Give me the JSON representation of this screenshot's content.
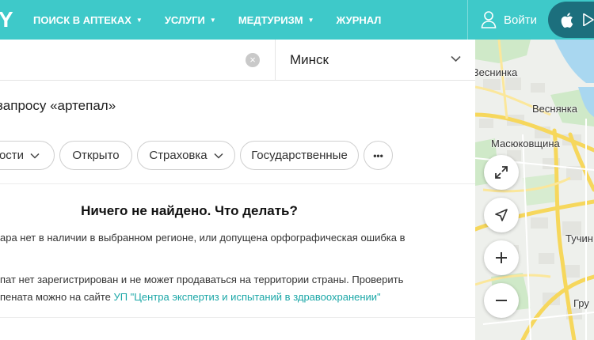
{
  "header": {
    "logo_text": "Y",
    "nav": [
      {
        "label": "ПОИСК В АПТЕКАХ",
        "has_caret": true
      },
      {
        "label": "УСЛУГИ",
        "has_caret": true
      },
      {
        "label": "МЕДТУРИЗМ",
        "has_caret": true
      },
      {
        "label": "ЖУРНАЛ",
        "has_caret": false
      }
    ],
    "login_label": "Войти"
  },
  "search": {
    "value": "",
    "city": "Минск"
  },
  "results_title": "запросу «артепал»",
  "filters": [
    {
      "label": "ости",
      "has_chevron": true
    },
    {
      "label": "Открыто",
      "has_chevron": false
    },
    {
      "label": "Страховка",
      "has_chevron": true
    },
    {
      "label": "Государственные",
      "has_chevron": false
    },
    {
      "label": "•••",
      "has_chevron": false
    }
  ],
  "empty_state": {
    "title": "Ничего не найдено. Что делать?",
    "hint1": "ара нет в наличии в выбранном регионе, или допущена орфографическая ошибка в",
    "hint2_line1": "пат нет зарегистрирован и не может продаваться на территории страны. Проверить",
    "hint2_line2_prefix": "пената можно на сайте ",
    "hint2_link": "УП \"Центра экспертиз и испытаний в здравоохранении\""
  },
  "map": {
    "labels": {
      "vesninka1": "Веснинка",
      "vesninka2": "Веснянка",
      "masyukovshchina": "Масюковщина",
      "tuchinka": "Тучин",
      "gru": "Гру"
    },
    "road_color": "#f6d75c",
    "water_color": "#a9d7f0",
    "park_color": "#cfe9c8"
  },
  "colors": {
    "header_bg": "#3ec9c9",
    "app_pill_bg": "#1c6f7d",
    "link": "#1aa7a7"
  }
}
